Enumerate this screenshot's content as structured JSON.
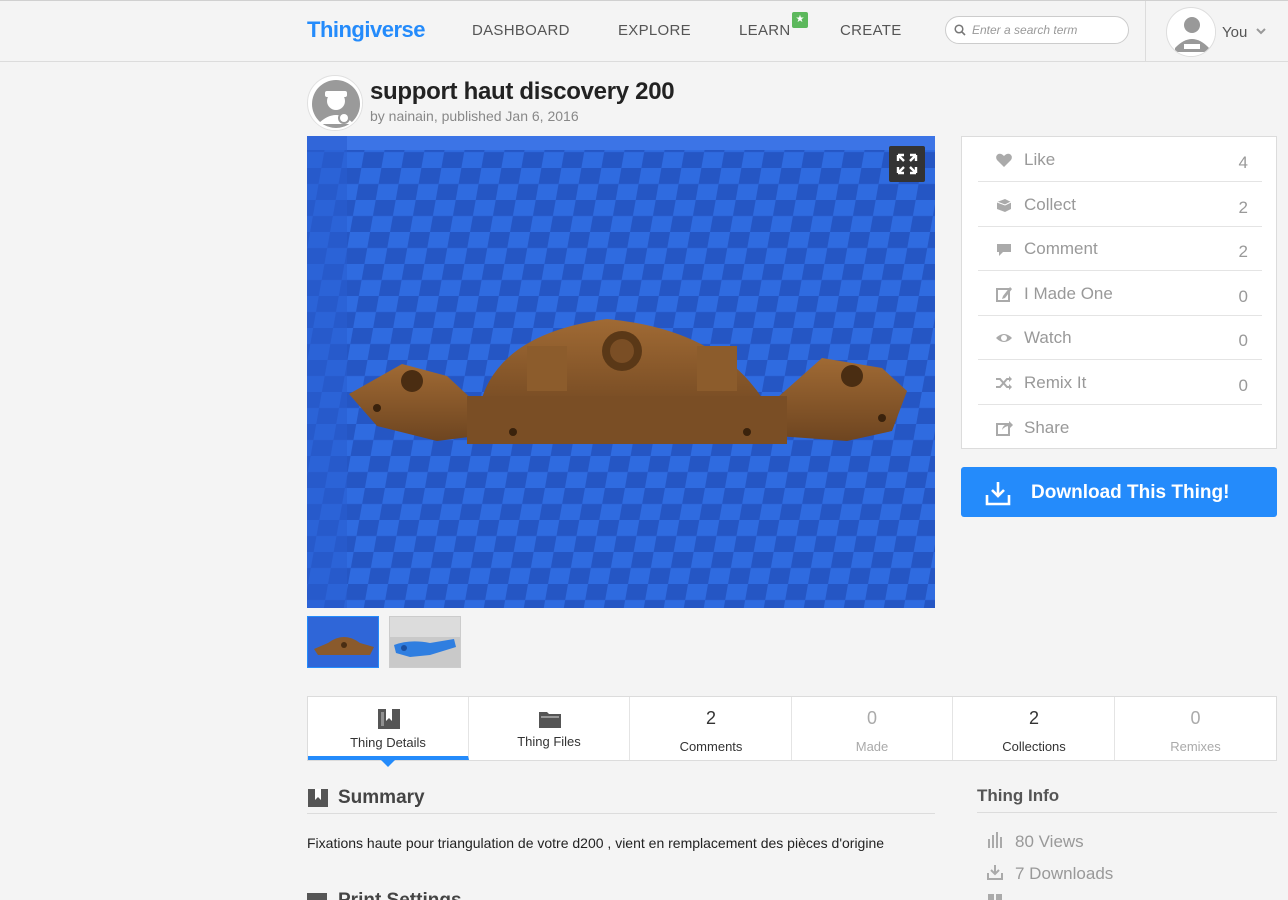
{
  "header": {
    "logo": "Thingiverse",
    "nav": [
      "DASHBOARD",
      "EXPLORE",
      "LEARN",
      "CREATE"
    ],
    "search_placeholder": "Enter a search term",
    "user_label": "You"
  },
  "thing": {
    "title": "support haut discovery 200",
    "byline": "by nainain, published Jan 6, 2016"
  },
  "actions": [
    {
      "label": "Like",
      "count": "4",
      "icon": "heart-icon"
    },
    {
      "label": "Collect",
      "count": "2",
      "icon": "collect-icon"
    },
    {
      "label": "Comment",
      "count": "2",
      "icon": "comment-icon"
    },
    {
      "label": "I Made One",
      "count": "0",
      "icon": "edit-icon"
    },
    {
      "label": "Watch",
      "count": "0",
      "icon": "eye-icon"
    },
    {
      "label": "Remix It",
      "count": "0",
      "icon": "shuffle-icon"
    },
    {
      "label": "Share",
      "count": "",
      "icon": "share-icon"
    }
  ],
  "download_label": "Download This Thing!",
  "tabs": [
    {
      "label": "Thing Details",
      "num": ""
    },
    {
      "label": "Thing Files",
      "num": ""
    },
    {
      "label": "Comments",
      "num": "2"
    },
    {
      "label": "Made",
      "num": "0"
    },
    {
      "label": "Collections",
      "num": "2"
    },
    {
      "label": "Remixes",
      "num": "0"
    }
  ],
  "summary": {
    "title": "Summary",
    "text": "Fixations haute pour triangulation de votre d200 , vient en remplacement des pièces d'origine"
  },
  "print_settings_title": "Print Settings",
  "thing_info": {
    "title": "Thing Info",
    "views": "80 Views",
    "downloads": "7 Downloads"
  },
  "colors": {
    "brand": "#248bfb",
    "learn_badge": "#5cb85c",
    "muted_text": "#999999"
  }
}
